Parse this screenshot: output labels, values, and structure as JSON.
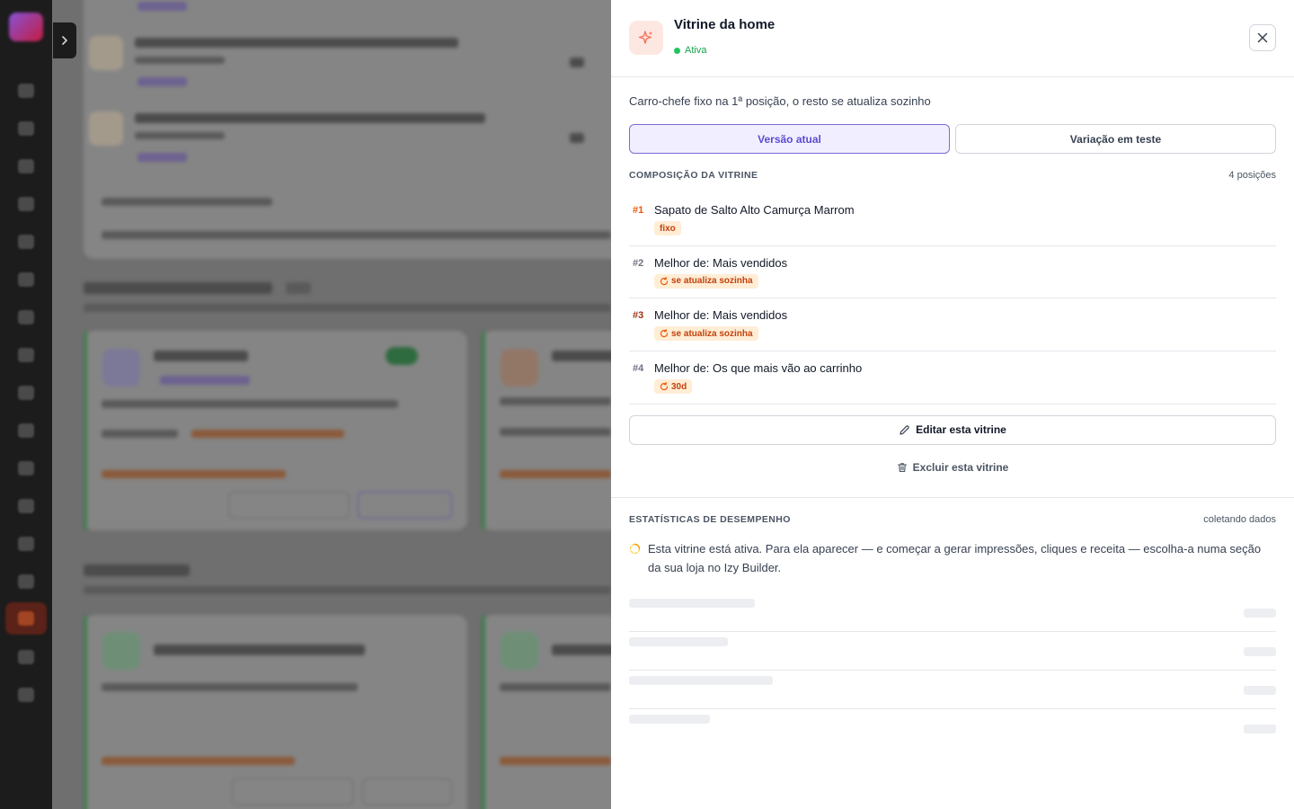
{
  "panel": {
    "title": "Vitrine da home",
    "status": "Ativa",
    "description": "Carro-chefe fixo na 1ª posição, o resto se atualiza sozinho",
    "tabs": [
      {
        "label": "Versão atual",
        "active": true
      },
      {
        "label": "Variação em teste",
        "active": false
      }
    ],
    "composition": {
      "title": "COMPOSIÇÃO DA VITRINE",
      "count": "4 posições",
      "items": [
        {
          "rank": "#1",
          "name": "Sapato de Salto Alto Camurça Marrom",
          "badge": "fixo",
          "badge_icon": ""
        },
        {
          "rank": "#2",
          "name": "Melhor de: Mais vendidos",
          "badge": "se atualiza sozinha",
          "badge_icon": "refresh-icon"
        },
        {
          "rank": "#3",
          "name": "Melhor de: Mais vendidos",
          "badge": "se atualiza sozinha",
          "badge_icon": "refresh-icon"
        },
        {
          "rank": "#4",
          "name": "Melhor de: Os que mais vão ao carrinho",
          "badge": "30d",
          "badge_icon": "refresh-icon"
        }
      ]
    },
    "edit_label": "Editar esta vitrine",
    "delete_label": "Excluir esta vitrine",
    "stats": {
      "title": "ESTATÍSTICAS DE DESEMPENHO",
      "meta": "coletando dados",
      "note": "Esta vitrine está ativa. Para ela aparecer — e começar a gerar impressões, cliques e receita — escolha-a numa seção da sua loja no Izy Builder."
    }
  },
  "colors": {
    "accent": "#5b4ccf",
    "status_green": "#22c55e",
    "badge_orange": "#c2410c",
    "icon_bg": "#fde8e1"
  }
}
